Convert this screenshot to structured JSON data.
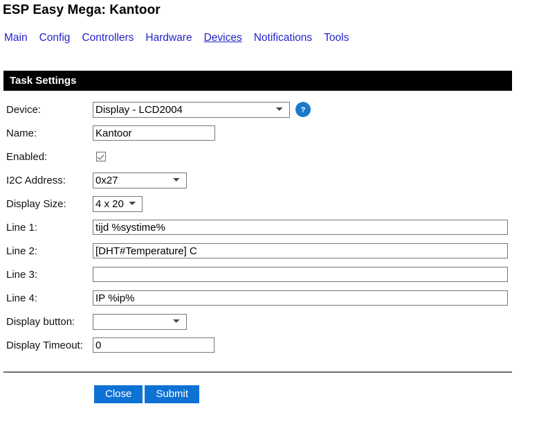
{
  "page": {
    "title": "ESP Easy Mega: Kantoor"
  },
  "nav": {
    "items": [
      {
        "label": "Main",
        "active": false
      },
      {
        "label": "Config",
        "active": false
      },
      {
        "label": "Controllers",
        "active": false
      },
      {
        "label": "Hardware",
        "active": false
      },
      {
        "label": "Devices",
        "active": true
      },
      {
        "label": "Notifications",
        "active": false
      },
      {
        "label": "Tools",
        "active": false
      }
    ]
  },
  "section": {
    "title": "Task Settings"
  },
  "form": {
    "device": {
      "label": "Device:",
      "value": "Display - LCD2004",
      "help_icon": "question-mark-icon"
    },
    "name": {
      "label": "Name:",
      "value": "Kantoor",
      "placeholder": ""
    },
    "enabled": {
      "label": "Enabled:",
      "checked": true
    },
    "i2c_address": {
      "label": "I2C Address:",
      "value": "0x27"
    },
    "display_size": {
      "label": "Display Size:",
      "value": "4 x 20"
    },
    "line1": {
      "label": "Line 1:",
      "value": "tijd %systime%",
      "placeholder": ""
    },
    "line2": {
      "label": "Line 2:",
      "value": "[DHT#Temperature] C",
      "placeholder": ""
    },
    "line3": {
      "label": "Line 3:",
      "value": "",
      "placeholder": ""
    },
    "line4": {
      "label": "Line 4:",
      "value": "IP %ip%",
      "placeholder": ""
    },
    "display_button": {
      "label": "Display button:",
      "value": ""
    },
    "display_timeout": {
      "label": "Display Timeout:",
      "value": "0",
      "placeholder": ""
    }
  },
  "actions": {
    "close_label": "Close",
    "submit_label": "Submit"
  },
  "colors": {
    "link": "#2222cc",
    "header_bar": "#000000",
    "button": "#0e72d4",
    "help_icon": "#1b79c9"
  }
}
